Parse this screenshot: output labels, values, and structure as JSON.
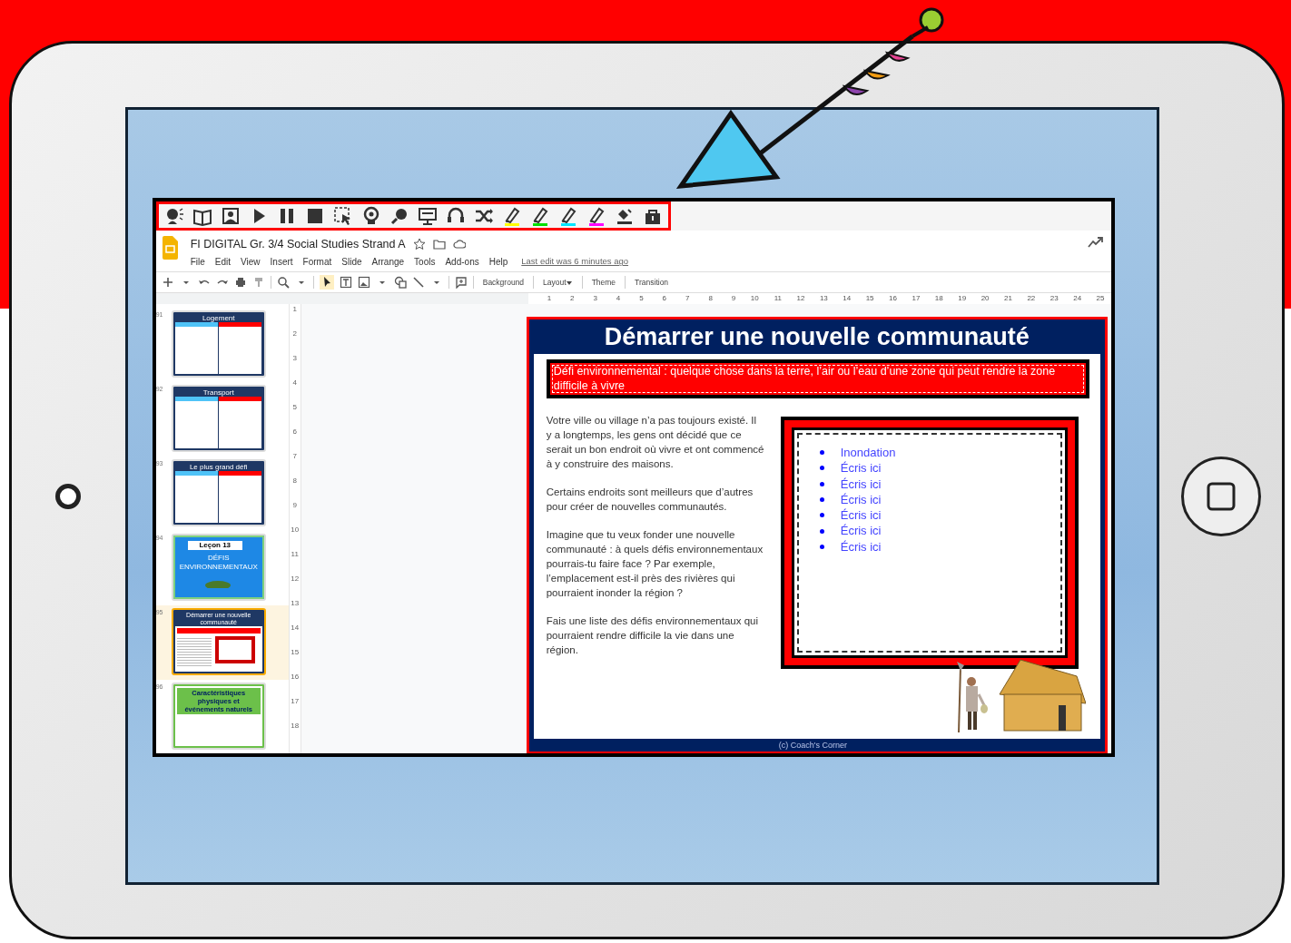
{
  "extension_toolbar": {
    "tools": [
      {
        "kind": "speaker"
      },
      {
        "kind": "book"
      },
      {
        "kind": "image"
      },
      {
        "kind": "play"
      },
      {
        "kind": "pause"
      },
      {
        "kind": "stop"
      },
      {
        "kind": "select"
      },
      {
        "kind": "head"
      },
      {
        "kind": "magnifier"
      },
      {
        "kind": "monitor"
      },
      {
        "kind": "headset"
      },
      {
        "kind": "shuffle"
      },
      {
        "kind": "highlighter",
        "color": "#ffff00"
      },
      {
        "kind": "highlighter",
        "color": "#00e000"
      },
      {
        "kind": "highlighter",
        "color": "#00e5ff"
      },
      {
        "kind": "highlighter",
        "color": "#ff00ff"
      },
      {
        "kind": "eraser"
      },
      {
        "kind": "box"
      }
    ]
  },
  "document": {
    "title": "FI DIGITAL Gr. 3/4 Social Studies Strand A",
    "menu": [
      "File",
      "Edit",
      "View",
      "Insert",
      "Format",
      "Slide",
      "Arrange",
      "Tools",
      "Add-ons",
      "Help"
    ],
    "last_edit": "Last edit was 6 minutes ago"
  },
  "toolbar": {
    "buttons": [
      "Background",
      "Layout",
      "Theme",
      "Transition"
    ]
  },
  "ruler": {
    "horizontal": [
      "1",
      "2",
      "3",
      "4",
      "5",
      "6",
      "7",
      "8",
      "9",
      "10",
      "11",
      "12",
      "13",
      "14",
      "15",
      "16",
      "17",
      "18",
      "19",
      "20",
      "21",
      "22",
      "23",
      "24",
      "25"
    ],
    "vertical": [
      "1",
      "2",
      "3",
      "4",
      "5",
      "6",
      "7",
      "8",
      "9",
      "10",
      "11",
      "12",
      "13",
      "14",
      "15",
      "16",
      "17",
      "18"
    ]
  },
  "filmstrip": [
    {
      "number": "91",
      "kind": "two-column",
      "title": "Logement",
      "selected": false
    },
    {
      "number": "92",
      "kind": "two-column",
      "title": "Transport",
      "selected": false
    },
    {
      "number": "93",
      "kind": "two-column",
      "title": "Le plus grand défi",
      "selected": false
    },
    {
      "number": "94",
      "kind": "lesson",
      "badge": "Leçon 13",
      "title": "DÉFIS ENVIRONNEMENTAUX",
      "selected": false
    },
    {
      "number": "95",
      "kind": "framed",
      "title": "Démarrer une nouvelle communauté",
      "selected": true
    },
    {
      "number": "96",
      "kind": "text",
      "title": "Caractéristiques physiques et événements naturels",
      "selected": false
    }
  ],
  "slide": {
    "title": "Démarrer une nouvelle communauté",
    "definition": "Défi environnemental : quelque chose dans la terre, l’air ou l’eau d’une zone qui peut rendre la zone difficile à vivre",
    "paragraphs": [
      "Votre ville ou village n’a pas toujours existé. Il y a longtemps, les gens ont décidé que ce serait un bon endroit où vivre et ont commencé à y construire des maisons.",
      "Certains endroits sont meilleurs que d’autres pour créer de nouvelles communautés.",
      "Imagine que tu veux fonder une nouvelle communauté : à quels défis environnementaux pourrais-tu faire face ? Par exemple, l’emplacement est-il près des rivières qui pourraient inonder la région ?",
      "Fais une liste des défis environnementaux qui pourraient rendre difficile la vie dans une région."
    ],
    "list": [
      "Inondation",
      "Écris ici",
      "Écris ici",
      "Écris ici",
      "Écris ici",
      "Écris ici",
      "Écris ici"
    ],
    "footer": "(c) Coach's Corner"
  }
}
